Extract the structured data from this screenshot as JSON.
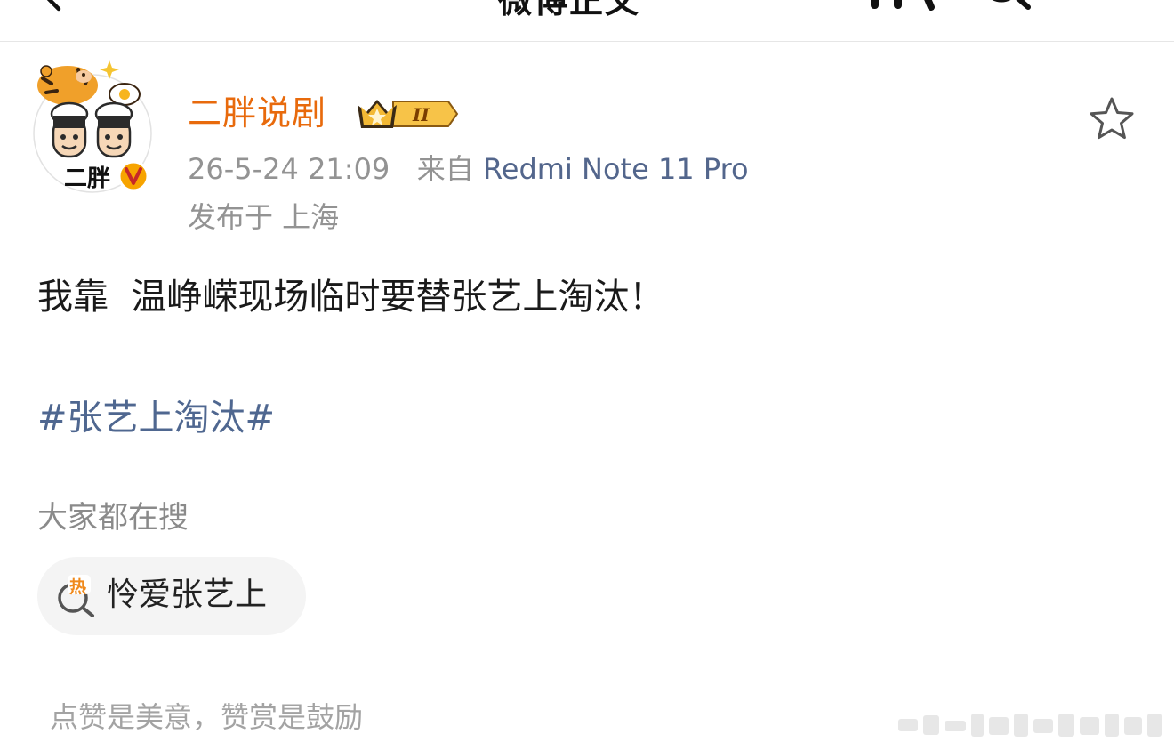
{
  "nav": {
    "title": "微博正文",
    "back_icon": "back-arrow-icon",
    "more_icon": "more-icon",
    "search_icon": "search-icon"
  },
  "author": {
    "name": "二胖说剧",
    "avatar_icon": "avatar-cartoon-chefs-tiger",
    "avatar_badge_text": "二胖",
    "verified_icon": "orange-v-verified-icon",
    "vip_badge_icon": "crown-vip-level-badge",
    "vip_level": "II",
    "timestamp": "26-5-24 21:09",
    "source_prefix": "来自",
    "device": "Redmi Note 11 Pro",
    "location": "发布于 上海",
    "favorite_icon": "star-icon"
  },
  "post": {
    "text": "我靠  温峥嵘现场临时要替张艺上淘汰！",
    "hashtag": "#张艺上淘汰#"
  },
  "everyone_searching": {
    "heading": "大家都在搜",
    "chips": [
      {
        "icon": "hot-search-icon",
        "icon_char": "热",
        "label": "怜爱张艺上"
      }
    ]
  },
  "footer": {
    "text": "点赞是美意，赞赏是鼓励"
  },
  "colors": {
    "author_name": "#e86a0c",
    "device_link": "#53668c",
    "hashtag": "#4f6790",
    "meta_gray": "#939393",
    "chip_bg": "#f4f4f4",
    "hot_icon": "#f08a1c"
  }
}
